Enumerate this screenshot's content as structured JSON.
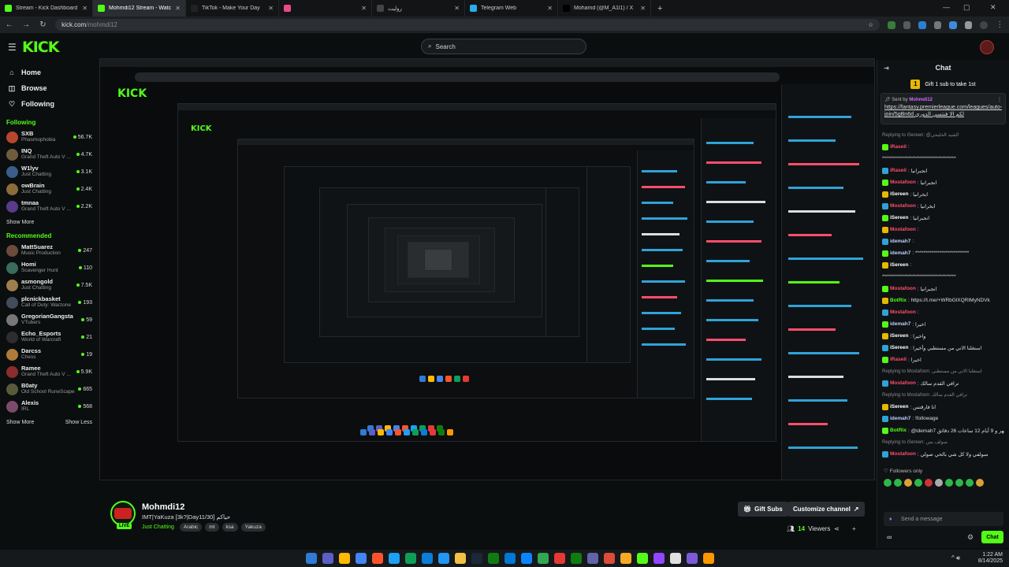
{
  "browser": {
    "tabs": [
      {
        "title": "Stream - Kick Dashboard",
        "color": "#53fc18"
      },
      {
        "title": "Mohmdi12 Stream - Watch Live",
        "color": "#53fc18"
      },
      {
        "title": "TikTok - Make Your Day",
        "color": "#222222"
      },
      {
        "title": "",
        "color": "#e94b8a"
      },
      {
        "title": "روليت",
        "color": "#444444"
      },
      {
        "title": "Telegram Web",
        "color": "#2aabee"
      },
      {
        "title": "Mohamd (@M_A1l1) / X",
        "color": "#000000"
      }
    ],
    "url_host": "kick.com",
    "url_path": "/mohmdi12"
  },
  "header": {
    "logo": "KICK",
    "search_placeholder": "Search"
  },
  "sidebar": {
    "nav": [
      {
        "label": "Home",
        "icon": "home-icon",
        "glyph": "⌂"
      },
      {
        "label": "Browse",
        "icon": "browse-icon",
        "glyph": "◫"
      },
      {
        "label": "Following",
        "icon": "heart-icon",
        "glyph": "♡"
      }
    ],
    "following_title": "Following",
    "following": [
      {
        "name": "SXB",
        "category": "Phasmophobia",
        "viewers": "56.7K",
        "color": "#b8452d"
      },
      {
        "name": "INQ",
        "category": "Grand Theft Auto V ...",
        "viewers": "4.7K",
        "color": "#6f5b3e"
      },
      {
        "name": "W1lyv",
        "category": "Just Chatting",
        "viewers": "3.1K",
        "color": "#3b5d8a"
      },
      {
        "name": "owBrain",
        "category": "Just Chatting",
        "viewers": "2.4K",
        "color": "#8a6d3b"
      },
      {
        "name": "tmnaa",
        "category": "Grand Theft Auto V ...",
        "viewers": "2.2K",
        "color": "#5a3b8a"
      }
    ],
    "show_more": "Show More",
    "recommended_title": "Recommended",
    "recommended": [
      {
        "name": "MattSuarez",
        "category": "Music Production",
        "viewers": "247",
        "color": "#6b4b3b"
      },
      {
        "name": "Homi",
        "category": "Scavenger Hunt",
        "viewers": "110",
        "color": "#3b6b5a"
      },
      {
        "name": "asmongold",
        "category": "Just Chatting",
        "viewers": "7.5K",
        "color": "#a07d4d"
      },
      {
        "name": "plcnickbasket",
        "category": "Call of Duty: Warzone",
        "viewers": "193",
        "color": "#444c5a"
      },
      {
        "name": "GregorianGangsta",
        "category": "VTubers",
        "viewers": "59",
        "color": "#777777"
      },
      {
        "name": "Echo_Esports",
        "category": "World of Warcraft",
        "viewers": "21",
        "color": "#2d2d2d"
      },
      {
        "name": "Darcss",
        "category": "Chess",
        "viewers": "19",
        "color": "#b07a3a"
      },
      {
        "name": "Ramee",
        "category": "Grand Theft Auto V ...",
        "viewers": "5.9K",
        "color": "#8a2d2d"
      },
      {
        "name": "B0aty",
        "category": "Old School RuneScape",
        "viewers": "665",
        "color": "#5a5a3b"
      },
      {
        "name": "Alexis",
        "category": "IRL",
        "viewers": "568",
        "color": "#7a4b6b"
      }
    ],
    "show_more_2": "Show More",
    "show_less": "Show Less"
  },
  "channel": {
    "name": "Mohmdi12",
    "live_badge": "LIVE",
    "title": "IMT|YaKuza [3k?|Day11/30] حياكم",
    "category": "Just Chatting",
    "tags": [
      "Arabic",
      "mt",
      "ksa",
      "Yakuza"
    ],
    "gift_subs_label": "Gift Subs",
    "customize_label": "Customize channel",
    "viewers": "14",
    "viewers_label": "Viewers"
  },
  "chat": {
    "title": "Chat",
    "gift_banner": "Gift 1 sub to take 1st",
    "pinned_by_label": "Sent by",
    "pinned_by": "Mohmdi12",
    "pinned_link": "https://fantasy.premierleague.com/leagues/auto-join/5gBn6d  لكم الا فنتسي الدوري",
    "messages": [
      {
        "user": "",
        "text": "Replying to iSereen: @الشيد الخليجي",
        "reply": true,
        "color": "#888888"
      },
      {
        "user": "iRaseil",
        "text": ":",
        "color": "#ff4d6d"
      },
      {
        "user": "",
        "text": "*************************************",
        "color": "#dddddd"
      },
      {
        "user": "iRaseil",
        "text": ": انجبرانيا",
        "color": "#ff4d6d"
      },
      {
        "user": "Mostafoon",
        "text": ": انجبرانيا",
        "color": "#ff4d6d"
      },
      {
        "user": "iSereen",
        "text": ": ابخرانيا",
        "color": "#ffffff"
      },
      {
        "user": "Mostafoon",
        "text": ": ابخرانيا",
        "color": "#ff4d6d"
      },
      {
        "user": "iSereen",
        "text": ": انجبرانيا",
        "color": "#ffffff"
      },
      {
        "user": "Mostafoon",
        "text": ":",
        "color": "#ff4d6d"
      },
      {
        "user": "idemah7",
        "text": ":",
        "color": "#bcd1ff"
      },
      {
        "user": "idemah7",
        "text": ": ***************************",
        "color": "#bcd1ff"
      },
      {
        "user": "iSereen",
        "text": ":",
        "color": "#ffffff"
      },
      {
        "user": "",
        "text": "*************************************",
        "color": "#dddddd"
      },
      {
        "user": "Mostafoon",
        "text": ": انجبرانيا",
        "color": "#ff4d6d"
      },
      {
        "user": "BotRix",
        "text": ": https://t.me/+WRbGlXQRtMyNDVk",
        "color": "#53fc18"
      },
      {
        "user": "Mostafoon",
        "text": ":",
        "color": "#ff4d6d"
      },
      {
        "user": "idemah7",
        "text": ": اخيرا",
        "color": "#bcd1ff"
      },
      {
        "user": "iSereen",
        "text": ": واخيرا",
        "color": "#ffffff"
      },
      {
        "user": "iSereen",
        "text": ": استغلنا الاني من مستطبي وأخيرا",
        "color": "#ffffff"
      },
      {
        "user": "iRaseil",
        "text": ": اخيرا",
        "color": "#ff4d6d"
      },
      {
        "user": "",
        "text": "Replying to Mostafoon: استغلنا الاني من مستطبي",
        "reply": true,
        "color": "#888888"
      },
      {
        "user": "Mostafoon",
        "text": ": ترافي القدم سالك",
        "color": "#ff4d6d"
      },
      {
        "user": "",
        "text": "Replying to Mostafoon: ترافي القدم سالك",
        "reply": true,
        "color": "#888888"
      },
      {
        "user": "iSereen",
        "text": ": انا فارقتس",
        "color": "#ffffff"
      },
      {
        "user": "idemah7",
        "text": ": !followage",
        "color": "#bcd1ff"
      },
      {
        "user": "BotRix",
        "text": ": @idemah7 يتابع هذا القناة لـ 6 أشهر و 9 أيام 12 ساعات 26 دقائق",
        "color": "#53fc18"
      },
      {
        "user": "",
        "text": "Replying to iSereen: سولف بس",
        "reply": true,
        "color": "#888888"
      },
      {
        "user": "Mostafoon",
        "text": ": سولفي ولا كل شي بالحي صولي",
        "color": "#ff4d6d"
      }
    ],
    "followers_only": "Followers only",
    "input_placeholder": "Send a message",
    "chat_button": "Chat"
  },
  "taskbar": {
    "time": "1:22 AM",
    "date": "8/14/2025",
    "icons": [
      "#2f7bd8",
      "#5b5fc7",
      "#ffb900",
      "#4285f4",
      "#fb542b",
      "#1da1f2",
      "#0f9d58",
      "#0b7dda",
      "#2196f3",
      "#f3c244",
      "#1b2838",
      "#107c10",
      "#0078d4",
      "#0a84ff",
      "#33a852",
      "#e53935",
      "#107c10",
      "#6264a7",
      "#dd4b39",
      "#f9a825",
      "#53fc18",
      "#9146ff",
      "#e0e0e0",
      "#7b5bd6",
      "#ff9800"
    ]
  }
}
